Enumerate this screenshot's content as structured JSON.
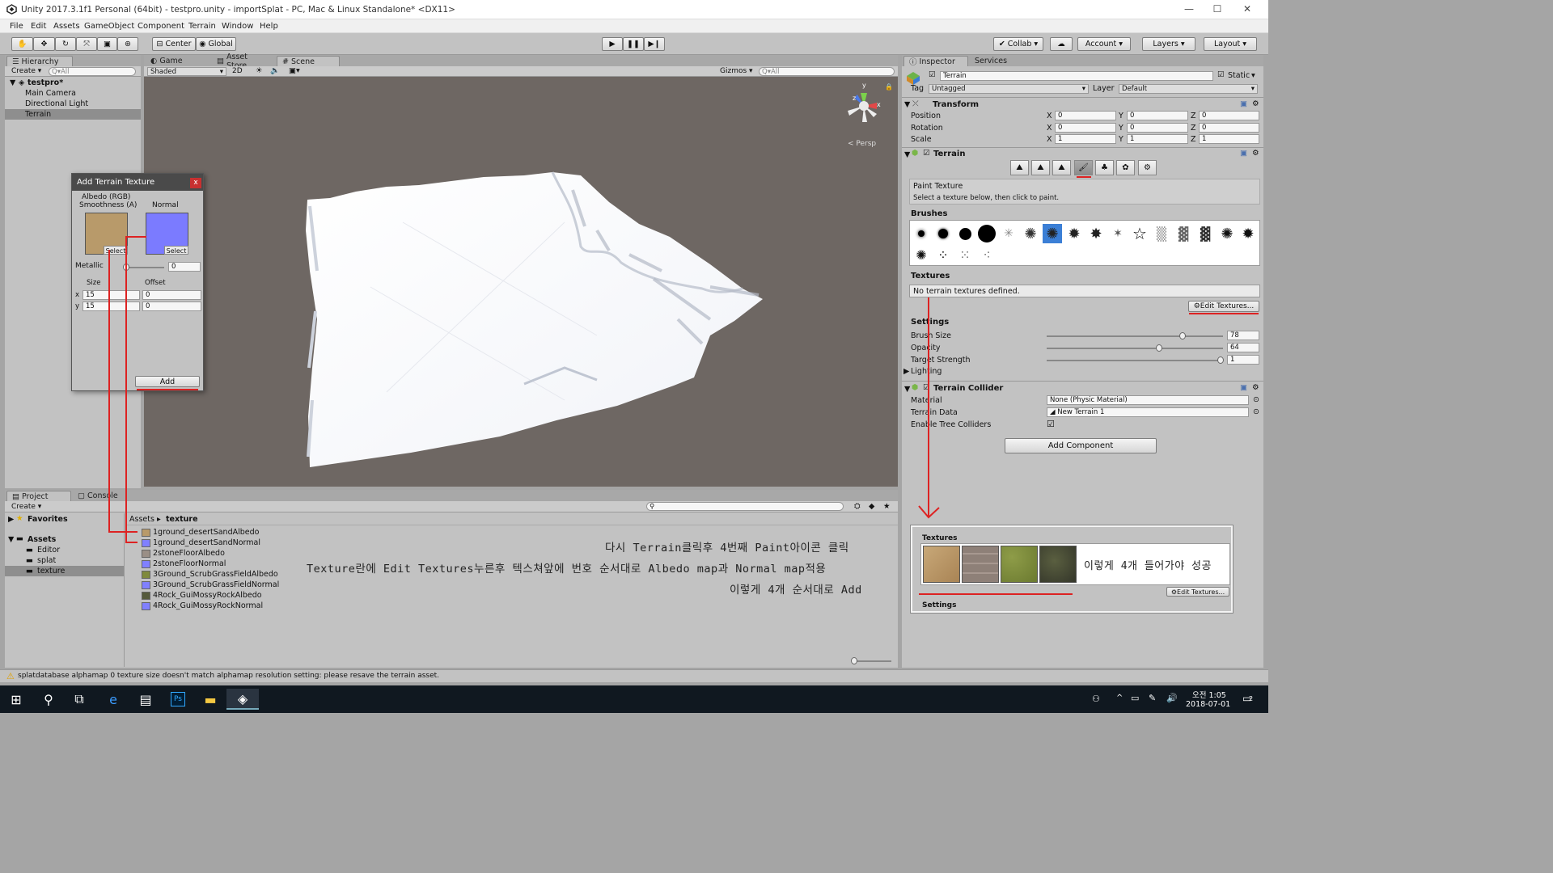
{
  "window": {
    "title": "Unity 2017.3.1f1 Personal (64bit) - testpro.unity - importSplat - PC, Mac & Linux Standalone* <DX11>",
    "controls": [
      "—",
      "☐",
      "✕"
    ]
  },
  "menu": [
    "File",
    "Edit",
    "Assets",
    "GameObject",
    "Component",
    "Terrain",
    "Window",
    "Help"
  ],
  "toolbar": {
    "center_label": "Center",
    "global_label": "Global",
    "collab_label": "Collab ▾",
    "account_label": "Account",
    "layers_label": "Layers",
    "layout_label": "Layout"
  },
  "hierarchy": {
    "tab": "Hierarchy",
    "create_label": "Create ▾",
    "search_placeholder": "Q▾All",
    "scene_name": "testpro*",
    "items": [
      "Main Camera",
      "Directional Light",
      "Terrain"
    ]
  },
  "scene_tabs": [
    "Game",
    "Asset Store",
    "Scene"
  ],
  "scene_toolbar": {
    "shading": "Shaded",
    "mode_2d": "2D",
    "gizmos": "Gizmos ▾",
    "search_placeholder": "Q▾All",
    "persp": "< Persp",
    "axis_y": "y",
    "axis_z": "z",
    "axis_x": "x"
  },
  "dialog": {
    "title": "Add Terrain Texture",
    "close": "x",
    "albedo_label": "Albedo (RGB)\nSmoothness (A)",
    "albedo_line1": "Albedo (RGB)",
    "albedo_line2": "Smoothness (A)",
    "normal_label": "Normal",
    "select_label": "Select",
    "metallic_label": "Metallic",
    "metallic_value": "0",
    "size_label": "Size",
    "offset_label": "Offset",
    "x_label": "x",
    "y_label": "y",
    "size_x": "15",
    "size_y": "15",
    "offset_x": "0",
    "offset_y": "0",
    "add_label": "Add",
    "albedo_color": "#b89a6a",
    "normal_color": "#7b7bff"
  },
  "project": {
    "tabs": [
      "Project",
      "Console"
    ],
    "create_label": "Create ▾",
    "favorites": "Favorites",
    "assets": "Assets",
    "folders": [
      "Editor",
      "splat",
      "texture"
    ],
    "breadcrumb_root": "Assets",
    "breadcrumb_sep": "▸",
    "breadcrumb_current": "texture",
    "files": [
      {
        "name": "1ground_desertSandAlbedo",
        "color": "#b89a6a"
      },
      {
        "name": "1ground_desertSandNormal",
        "color": "#8080ff"
      },
      {
        "name": "2stoneFloorAlbedo",
        "color": "#9a8f86"
      },
      {
        "name": "2stoneFloorNormal",
        "color": "#8080ff"
      },
      {
        "name": "3Ground_ScrubGrassFieldAlbedo",
        "color": "#7f8a3c"
      },
      {
        "name": "3Ground_ScrubGrassFieldNormal",
        "color": "#8080ff"
      },
      {
        "name": "4Rock_GuiMossyRockAlbedo",
        "color": "#555a3c"
      },
      {
        "name": "4Rock_GuiMossyRockNormal",
        "color": "#8080ff"
      }
    ]
  },
  "annotations": {
    "line1": "다시 Terrain클릭후 4번째 Paint아이콘 클릭",
    "line2": "Texture란에 Edit Textures누른후 텍스쳐앞에 번호 순서대로 Albedo map과 Normal map적용",
    "line3": "이렇게 4개 순서대로 Add",
    "success": "이렇게 4개 들어가야 성공"
  },
  "inspector": {
    "tabs": [
      "Inspector",
      "Services"
    ],
    "object_name": "Terrain",
    "static_label": "Static",
    "tag_label": "Tag",
    "tag_value": "Untagged",
    "layer_label": "Layer",
    "layer_value": "Default",
    "transform": {
      "title": "Transform",
      "rows": [
        {
          "label": "Position",
          "x": "0",
          "y": "0",
          "z": "0"
        },
        {
          "label": "Rotation",
          "x": "0",
          "y": "0",
          "z": "0"
        },
        {
          "label": "Scale",
          "x": "1",
          "y": "1",
          "z": "1"
        }
      ]
    },
    "terrain": {
      "title": "Terrain",
      "paint_title": "Paint Texture",
      "paint_hint": "Select a texture below, then click to paint.",
      "brushes_label": "Brushes",
      "textures_label": "Textures",
      "no_textures": "No terrain textures defined.",
      "edit_textures": "Edit Textures...",
      "settings_label": "Settings",
      "brush_size_label": "Brush Size",
      "brush_size": "78",
      "opacity_label": "Opacity",
      "opacity": "64",
      "target_strength_label": "Target Strength",
      "target_strength": "1",
      "lighting_label": "Lighting"
    },
    "collider": {
      "title": "Terrain Collider",
      "material_label": "Material",
      "material_value": "None (Physic Material)",
      "data_label": "Terrain Data",
      "data_value": "New Terrain 1",
      "trees_label": "Enable Tree Colliders"
    },
    "add_component": "Add Component",
    "result": {
      "textures_label": "Textures",
      "edit_textures": "Edit Textures...",
      "settings_label": "Settings"
    }
  },
  "status": {
    "message": "splatdatabase alphamap 0 texture size doesn't match alphamap resolution setting: please resave the terrain asset."
  },
  "taskbar": {
    "time": "오전 1:05",
    "date": "2018-07-01",
    "notifications": "2"
  },
  "colors": {
    "accent_red": "#dd2222",
    "selection": "#8fa9d6",
    "dialog_header": "#4a4a4a"
  }
}
